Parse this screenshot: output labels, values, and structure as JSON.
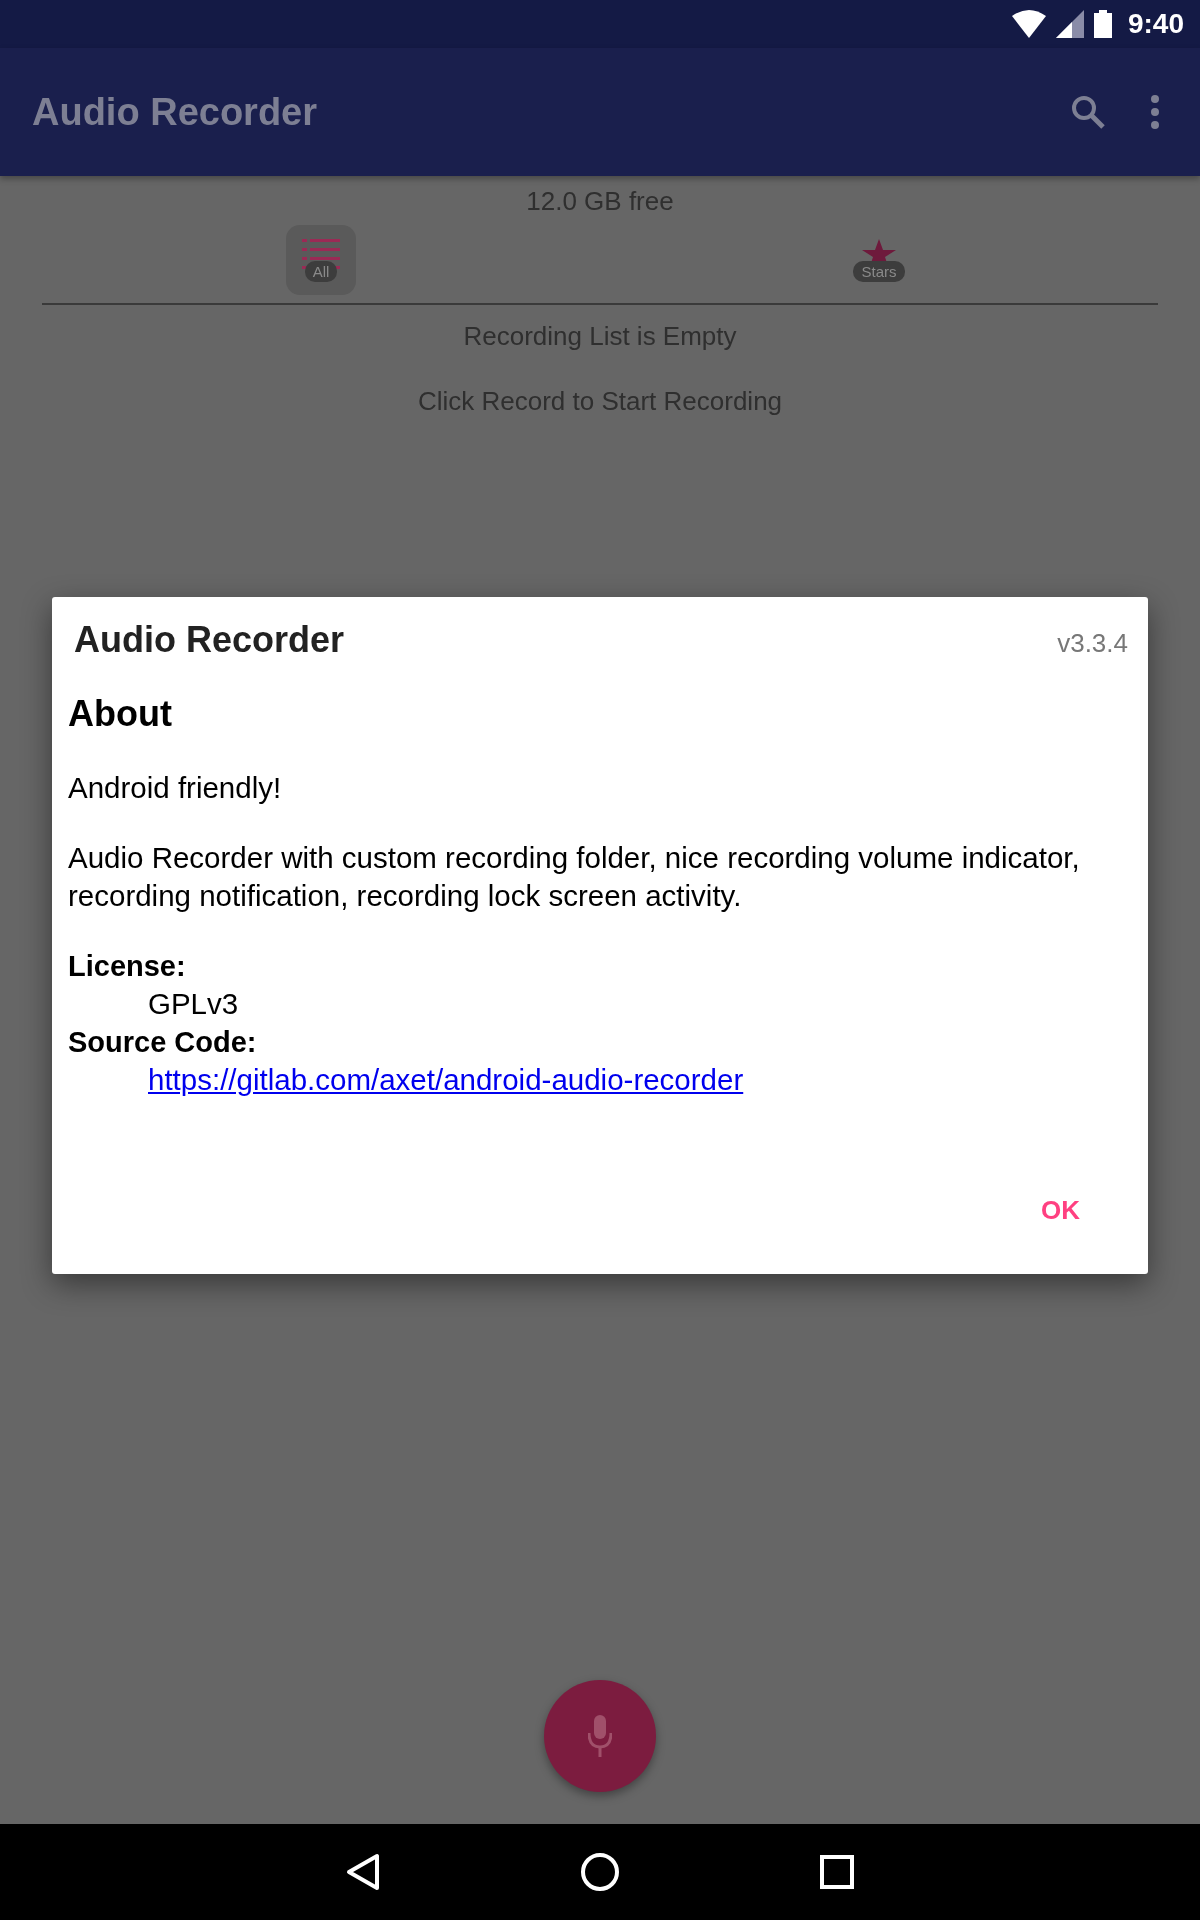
{
  "status_bar": {
    "time": "9:40"
  },
  "app_bar": {
    "title": "Audio Recorder"
  },
  "storage": "12.0 GB free",
  "tabs": [
    {
      "label": "All",
      "selected": true,
      "kind": "list"
    },
    {
      "label": "Stars",
      "selected": false,
      "kind": "star"
    }
  ],
  "empty_state": {
    "title": "Recording List is Empty",
    "hint": "Click Record to Start Recording"
  },
  "dialog": {
    "title": "Audio Recorder",
    "version": "v3.3.4",
    "heading": "About",
    "paragraphs": [
      "Android friendly!",
      "Audio Recorder with custom recording folder, nice recording volume indicator, recording notification, recording lock screen activity."
    ],
    "fields": [
      {
        "label": "License:",
        "value": "GPLv3",
        "kind": "text"
      },
      {
        "label": "Source Code:",
        "value": "https://gitlab.com/axet/android-audio-recorder",
        "kind": "link"
      }
    ],
    "button": "OK"
  }
}
